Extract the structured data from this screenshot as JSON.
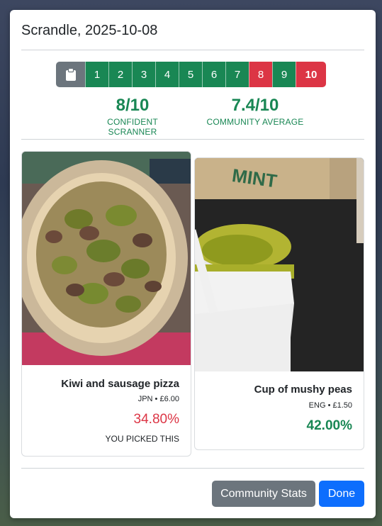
{
  "modal": {
    "title": "Scrandle, 2025-10-08"
  },
  "scorebar": {
    "icon": "clipboard-icon",
    "cells": [
      {
        "label": "1",
        "status": "green"
      },
      {
        "label": "2",
        "status": "green"
      },
      {
        "label": "3",
        "status": "green"
      },
      {
        "label": "4",
        "status": "green"
      },
      {
        "label": "5",
        "status": "green"
      },
      {
        "label": "6",
        "status": "green"
      },
      {
        "label": "7",
        "status": "green"
      },
      {
        "label": "8",
        "status": "red"
      },
      {
        "label": "9",
        "status": "green"
      },
      {
        "label": "10",
        "status": "red"
      }
    ]
  },
  "stats": {
    "player": {
      "score": "8/10",
      "label": "CONFIDENT SCRANNER"
    },
    "community": {
      "score": "7.4/10",
      "label": "COMMUNITY AVERAGE"
    }
  },
  "options": [
    {
      "name": "Kiwi and sausage pizza",
      "meta": "JPN • £6.00",
      "percent": "34.80%",
      "note": "YOU PICKED THIS"
    },
    {
      "name": "Cup of mushy peas",
      "meta": "ENG • £1.50",
      "percent": "42.00%"
    }
  ],
  "footer": {
    "stats_button": "Community Stats",
    "done_button": "Done"
  },
  "colors": {
    "green": "#198754",
    "red": "#dc3545",
    "secondary": "#6c757d",
    "primary": "#0d6efd"
  }
}
